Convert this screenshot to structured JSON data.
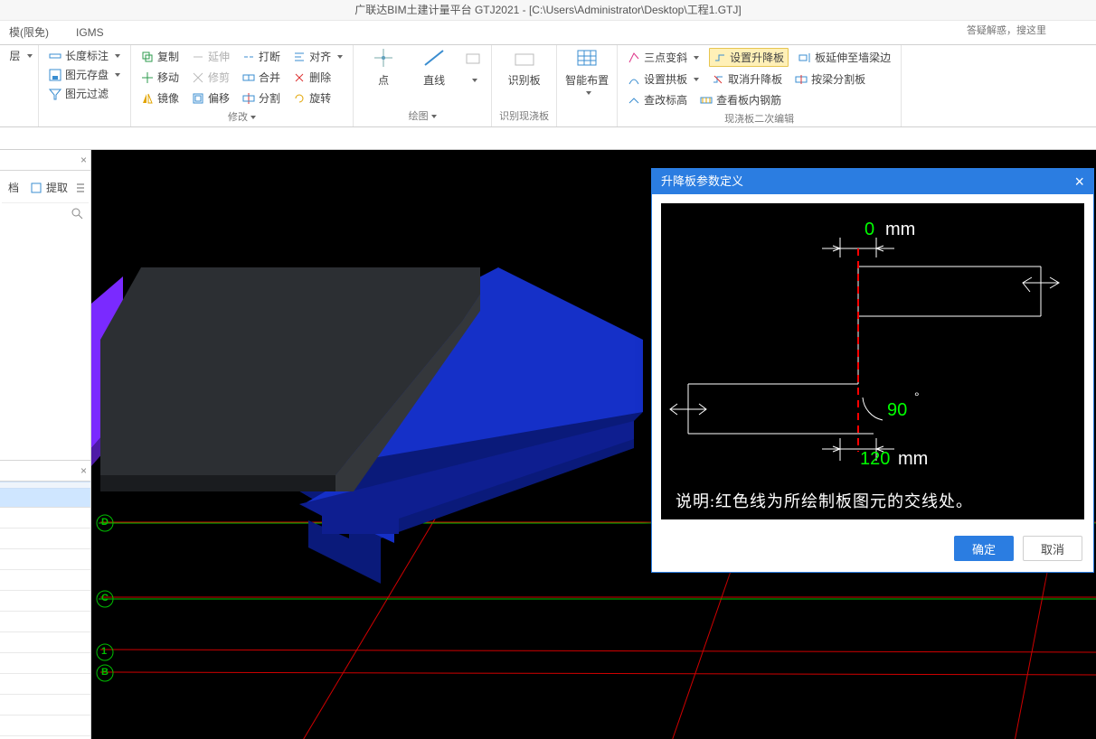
{
  "window": {
    "title": "广联达BIM土建计量平台 GTJ2021 - [C:\\Users\\Administrator\\Desktop\\工程1.GTJ]",
    "search_placeholder": "答疑解惑，搜这里"
  },
  "tabs": {
    "items": [
      {
        "label": "模(限免)"
      },
      {
        "label": "IGMS"
      }
    ]
  },
  "ribbon": {
    "grp_layer": {
      "label": "层",
      "layer": "层"
    },
    "grp_dim": {
      "length": "长度标注",
      "save": "图元存盘",
      "filter": "图元过滤"
    },
    "grp_modify": {
      "label": "修改",
      "copy": "复制",
      "move": "移动",
      "mirror": "镜像",
      "extend": "延伸",
      "trim": "修剪",
      "offset": "偏移",
      "break": "打断",
      "merge": "合并",
      "split": "分割",
      "align": "对齐",
      "delete": "删除",
      "rotate": "旋转"
    },
    "grp_draw": {
      "label": "绘图",
      "point": "点",
      "line": "直线"
    },
    "grp_recognize": {
      "label": "识别现浇板",
      "big": "识别板"
    },
    "grp_smart": {
      "big": "智能布置"
    },
    "grp_edit": {
      "label": "现浇板二次编辑",
      "r1c1": "三点变斜",
      "r1c2": "设置升降板",
      "r1c3": "板延伸至墙梁边",
      "r2c1": "设置拱板",
      "r2c2": "取消升降板",
      "r2c3": "按梁分割板",
      "r3c1": "查改标高",
      "r3c2": "查看板内钢筋"
    }
  },
  "left_panel": {
    "btn1": "档",
    "btn2": "提取"
  },
  "dialog": {
    "title": "升降板参数定义",
    "unit": "mm",
    "top_value": "0",
    "angle_value": "90",
    "angle_symbol": "°",
    "bottom_value": "120",
    "note": "说明:红色线为所绘制板图元的交线处。",
    "ok": "确定",
    "cancel": "取消"
  },
  "axes": {
    "d": "D",
    "c": "C",
    "one": "1",
    "b": "B"
  }
}
